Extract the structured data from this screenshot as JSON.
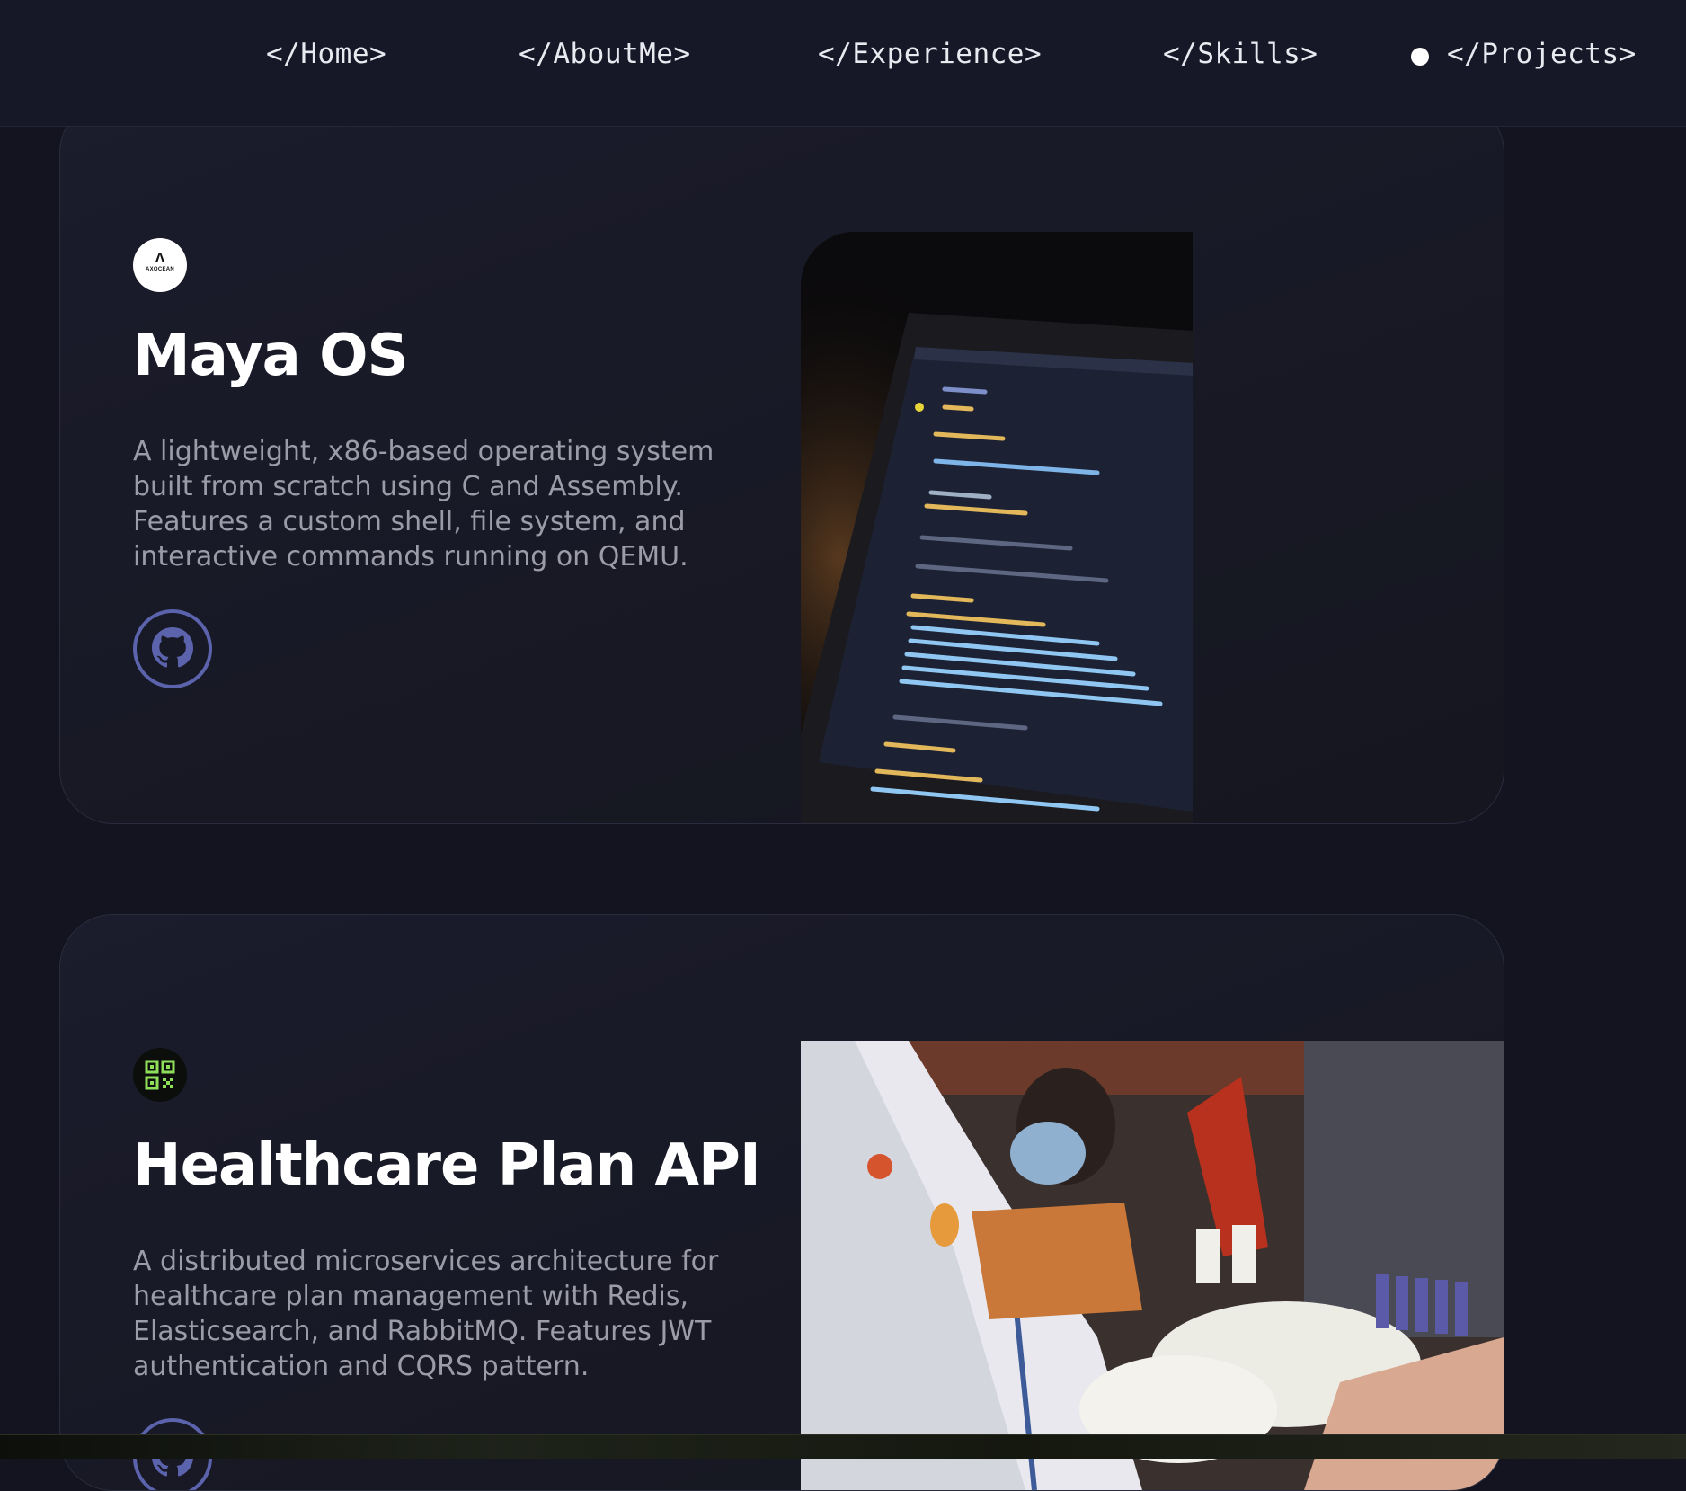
{
  "nav": {
    "items": [
      {
        "label": "</Home>"
      },
      {
        "label": "</AboutMe>"
      },
      {
        "label": "</Experience>"
      },
      {
        "label": "</Skills>"
      },
      {
        "label": "</Projects>",
        "active": true
      }
    ]
  },
  "projects": [
    {
      "logo_icon": "axocean-logo-icon",
      "logo_text": "AXOCEAN",
      "title": "Maya OS",
      "description": "A lightweight, x86-based operating system built from scratch using C and Assembly. Features a custom shell, file system, and interactive commands running on QEMU.",
      "link_icon": "github-icon",
      "image": "laptop-code-screenshot"
    },
    {
      "logo_icon": "qr-code-icon",
      "title": "Healthcare Plan API",
      "description": "A distributed microservices architecture for healthcare plan management with Redis, Elasticsearch, and RabbitMQ. Features JWT authentication and CQRS pattern.",
      "link_icon": "github-icon",
      "image": "healthcare-blood-donation-photo"
    }
  ],
  "colors": {
    "background": "#141420",
    "navbar": "#171827",
    "card": "#1b1c2c",
    "accent": "#5c63ad",
    "title": "#ffffff",
    "description": "#9c9ca8"
  }
}
